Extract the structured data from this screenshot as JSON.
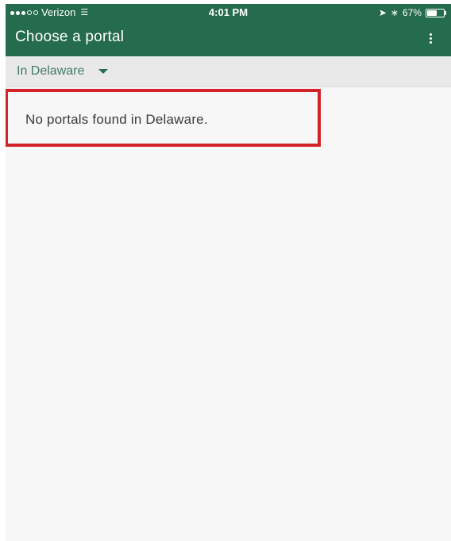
{
  "status_bar": {
    "carrier": "Verizon",
    "time": "4:01 PM",
    "battery_percent_label": "67%",
    "battery_level": 0.67,
    "icons": [
      "signal-dots",
      "wifi-icon",
      "location-arrow-icon",
      "bluetooth-icon",
      "battery-icon"
    ]
  },
  "app_bar": {
    "title": "Choose a portal",
    "overflow_icon": "more-vertical-icon"
  },
  "region": {
    "selected": "In Delaware",
    "dropdown_icon": "caret-down-icon"
  },
  "content": {
    "empty_message": "No portals found in Delaware."
  },
  "colors": {
    "primary": "#256b4d",
    "region_text": "#3f7a60",
    "highlight": "#d2232a"
  }
}
